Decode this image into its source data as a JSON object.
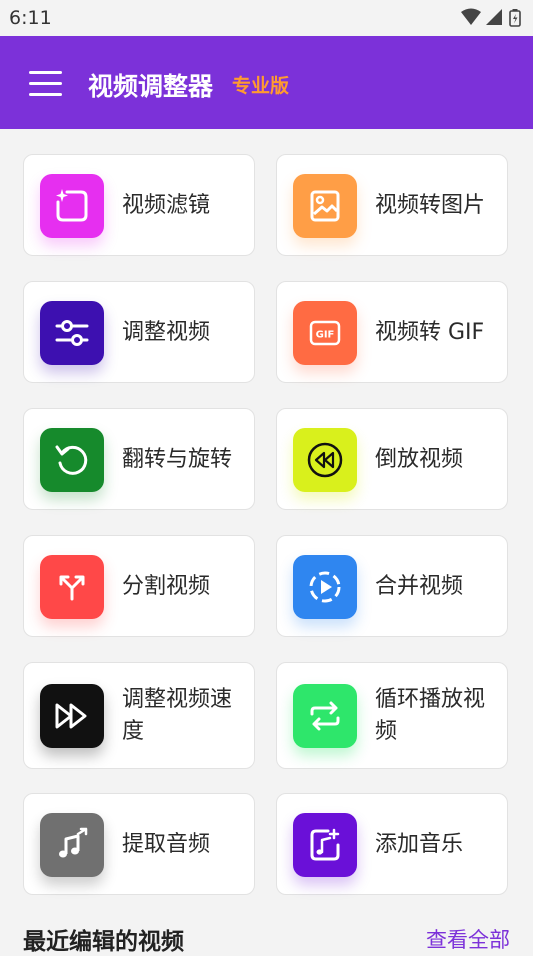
{
  "status_bar": {
    "time": "6:11"
  },
  "header": {
    "title": "视频调整器",
    "badge": "专业版"
  },
  "tools": [
    {
      "label": "视频滤镜",
      "icon": "sparkle-square-icon",
      "color": "#e62ff0"
    },
    {
      "label": "视频转图片",
      "icon": "image-icon",
      "color": "#ff9e46"
    },
    {
      "label": "调整视频",
      "icon": "sliders-icon",
      "color": "#3d10b0"
    },
    {
      "label": "视频转 GIF",
      "icon": "gif-icon",
      "color": "#ff6b43"
    },
    {
      "label": "翻转与旋转",
      "icon": "rotate-icon",
      "color": "#168a2c"
    },
    {
      "label": "倒放视频",
      "icon": "rewind-icon",
      "color": "#d9f01c"
    },
    {
      "label": "分割视频",
      "icon": "split-arrows-icon",
      "color": "#ff4848"
    },
    {
      "label": "合并视频",
      "icon": "merge-play-icon",
      "color": "#2f86f0"
    },
    {
      "label": "调整视频速度",
      "icon": "fast-forward-icon",
      "color": "#111111"
    },
    {
      "label": "循环播放视频",
      "icon": "loop-icon",
      "color": "#2ee66b"
    },
    {
      "label": "提取音频",
      "icon": "music-note-icon",
      "color": "#707070"
    },
    {
      "label": "添加音乐",
      "icon": "music-add-icon",
      "color": "#6a10d8"
    }
  ],
  "recent": {
    "title": "最近编辑的视频",
    "view_all": "查看全部"
  }
}
